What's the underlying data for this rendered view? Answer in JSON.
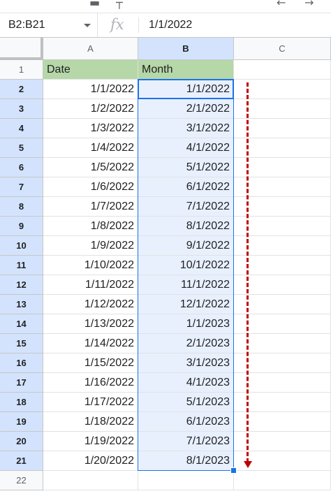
{
  "toolbar": {
    "icons": [
      "print-icon",
      "paint-format-icon",
      "undo-icon",
      "redo-icon"
    ]
  },
  "formula_bar": {
    "name_box": "B2:B21",
    "fx_label": "fx",
    "formula": "1/1/2022"
  },
  "columns": [
    "A",
    "B",
    "C"
  ],
  "rows": [
    "1",
    "2",
    "3",
    "4",
    "5",
    "6",
    "7",
    "8",
    "9",
    "10",
    "11",
    "12",
    "13",
    "14",
    "15",
    "16",
    "17",
    "18",
    "19",
    "20",
    "21",
    "22"
  ],
  "header_row": {
    "a": "Date",
    "b": "Month"
  },
  "dates": [
    "1/1/2022",
    "1/2/2022",
    "1/3/2022",
    "1/4/2022",
    "1/5/2022",
    "1/6/2022",
    "1/7/2022",
    "1/8/2022",
    "1/9/2022",
    "1/10/2022",
    "1/11/2022",
    "1/12/2022",
    "1/13/2022",
    "1/14/2022",
    "1/15/2022",
    "1/16/2022",
    "1/17/2022",
    "1/18/2022",
    "1/19/2022",
    "1/20/2022"
  ],
  "months": [
    "1/1/2022",
    "2/1/2022",
    "3/1/2022",
    "4/1/2022",
    "5/1/2022",
    "6/1/2022",
    "7/1/2022",
    "8/1/2022",
    "9/1/2022",
    "10/1/2022",
    "11/1/2022",
    "12/1/2022",
    "1/1/2023",
    "2/1/2023",
    "3/1/2023",
    "4/1/2023",
    "5/1/2023",
    "6/1/2023",
    "7/1/2023",
    "8/1/2023"
  ],
  "colors": {
    "header_fill": "#b6d7a8",
    "selection": "#1a73e8",
    "selection_fill": "#e8f0fe",
    "annotation_arrow": "#c00000"
  }
}
